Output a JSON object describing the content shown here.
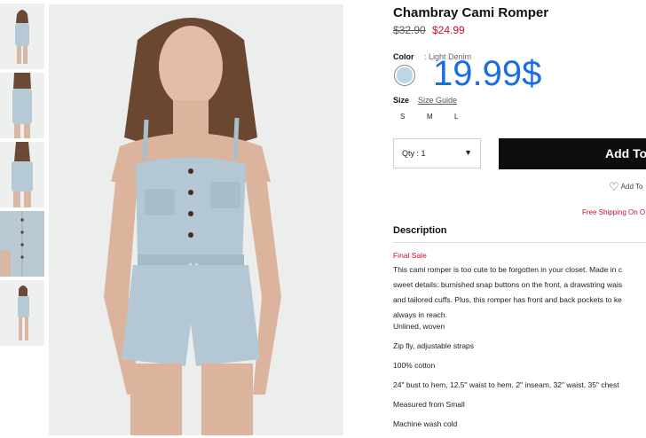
{
  "product": {
    "title": "Chambray Cami Romper",
    "price_original": "$32.90",
    "price_sale": "$24.99",
    "overlay_price": "19.99$"
  },
  "color": {
    "label": "Color",
    "value": ": Light Denim",
    "swatch_hex": "#bcd6e4"
  },
  "size": {
    "label": "Size",
    "guide_label": "Size Guide",
    "options": [
      "S",
      "M",
      "L"
    ]
  },
  "quantity": {
    "label": "Qty : 1"
  },
  "actions": {
    "add_to_bag": "Add To",
    "wishlist": "Add To"
  },
  "shipping_note": "Free Shipping On O",
  "description": {
    "heading": "Description",
    "final_sale": "Final Sale",
    "body_lines": [
      "This cami romper is too cute to be forgotten in your closet. Made in c",
      "sweet details: burnished snap buttons on the front, a drawstring wais",
      "and tailored cuffs. Plus, this romper has front and back pockets to ke",
      "always in reach."
    ],
    "details": [
      "Unlined, woven",
      "Zip fly, adjustable straps",
      "100% cotton",
      "24\" bust to hem, 12.5\" waist to hem, 2\" inseam, 32\" waist, 35\" chest",
      "Measured from Small",
      "Machine wash cold"
    ]
  },
  "colors": {
    "accent_red": "#c8102e",
    "overlay_blue": "#1a6fe0",
    "button_black": "#0d0d0d"
  }
}
